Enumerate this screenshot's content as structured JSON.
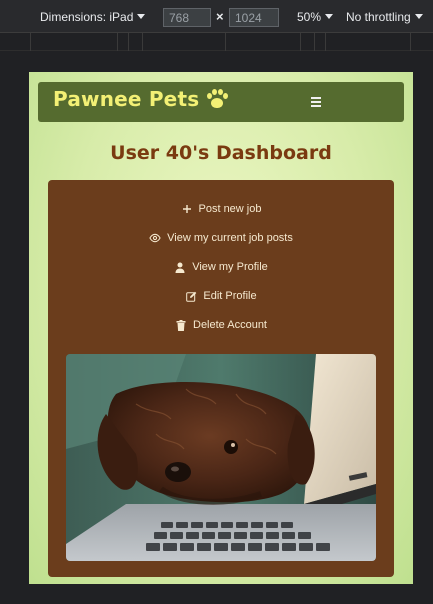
{
  "devtools": {
    "device_label": "Dimensions: iPad",
    "width_value": "768",
    "height_value": "1024",
    "times_symbol": "×",
    "zoom_label": "50%",
    "throttle_label": "No throttling"
  },
  "navbar": {
    "brand": "Pawnee Pets",
    "brand_icon": "paw-icon",
    "menu_icon": "hamburger-icon"
  },
  "page": {
    "title": "User 40's Dashboard"
  },
  "dashboard": {
    "links": [
      {
        "icon": "plus-icon",
        "label": "Post new job"
      },
      {
        "icon": "eye-icon",
        "label": "View my current job posts"
      },
      {
        "icon": "user-icon",
        "label": "View my Profile"
      },
      {
        "icon": "edit-icon",
        "label": "Edit Profile"
      },
      {
        "icon": "trash-icon",
        "label": "Delete Account"
      }
    ],
    "image_subject": "dog-on-laptop-photo"
  },
  "colors": {
    "navbar": "#556b2f",
    "brand_text": "#f3f075",
    "title": "#7a3a10",
    "panel": "#6b3d1c",
    "link_text": "#f6e9cf"
  }
}
